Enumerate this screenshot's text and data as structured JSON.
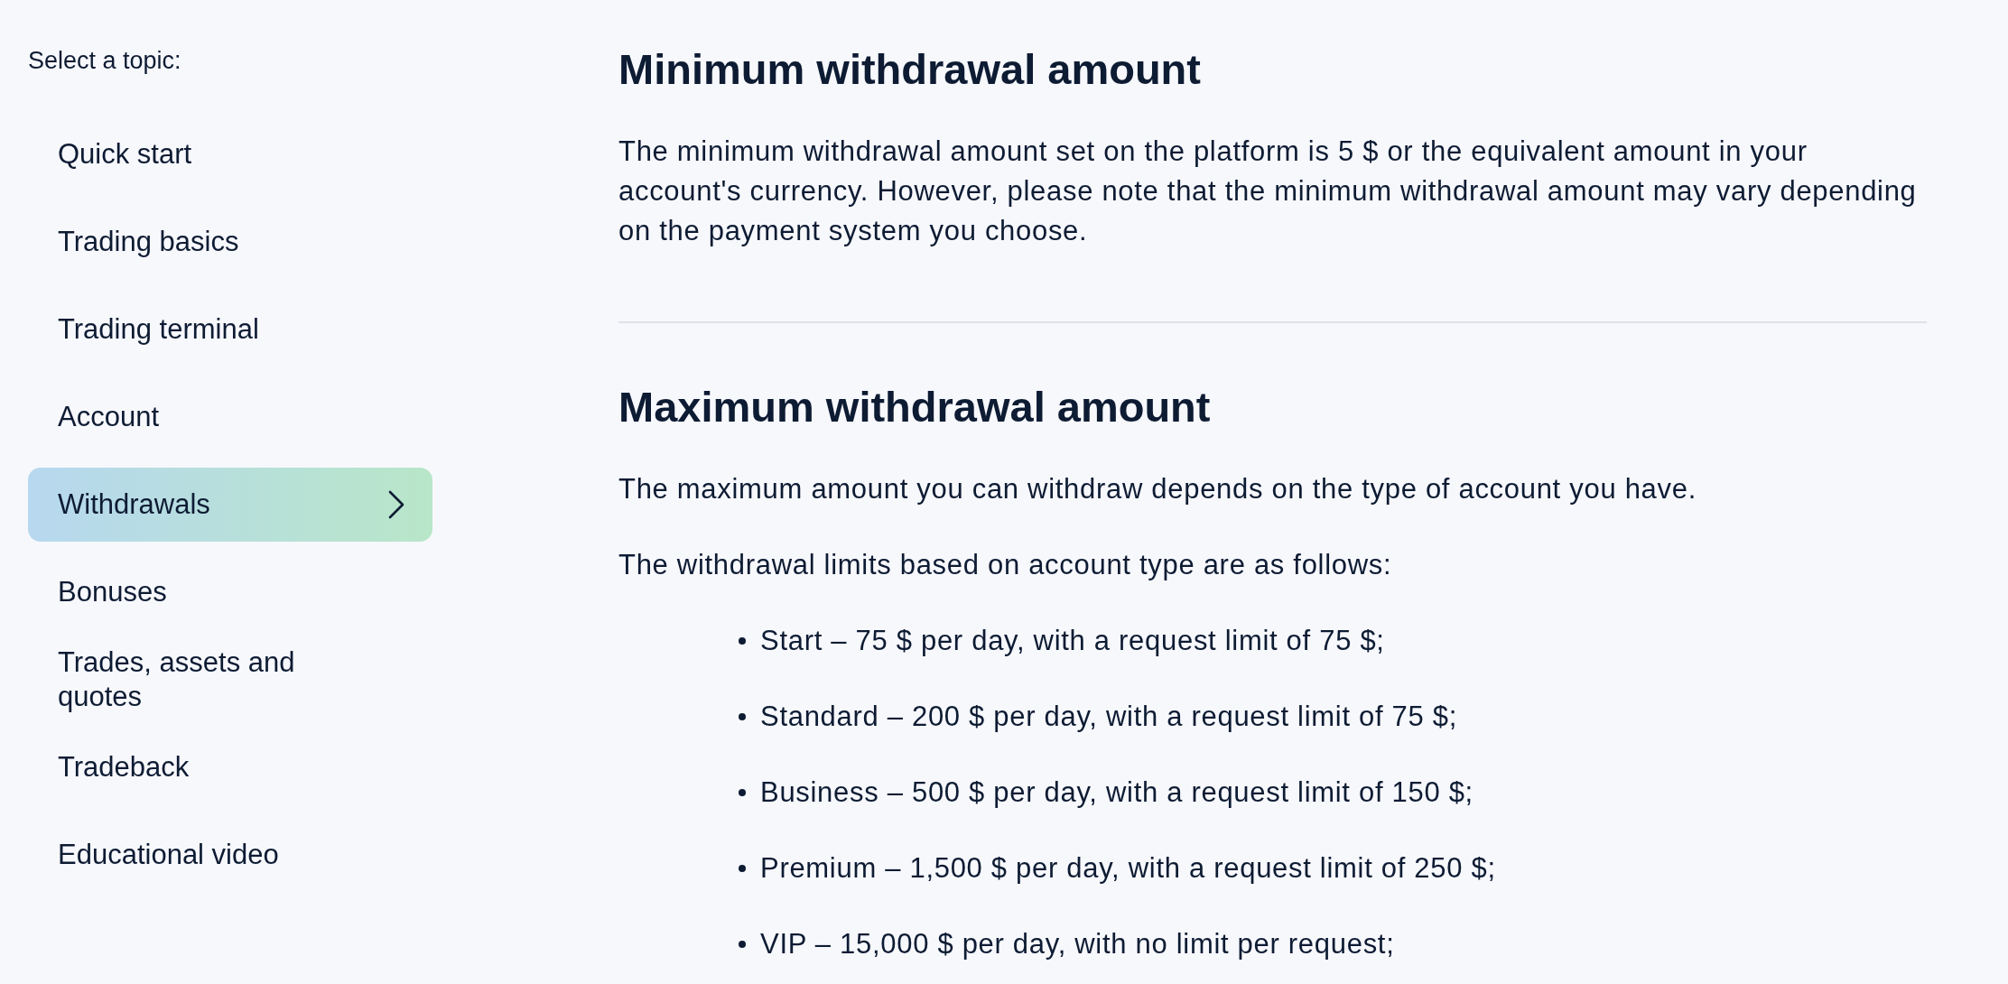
{
  "sidebar": {
    "title": "Select a topic:",
    "items": [
      {
        "label": "Quick start",
        "selected": false
      },
      {
        "label": "Trading basics",
        "selected": false
      },
      {
        "label": "Trading terminal",
        "selected": false
      },
      {
        "label": "Account",
        "selected": false
      },
      {
        "label": "Withdrawals",
        "selected": true
      },
      {
        "label": "Bonuses",
        "selected": false
      },
      {
        "label": "Trades, assets and quotes",
        "selected": false
      },
      {
        "label": "Tradeback",
        "selected": false
      },
      {
        "label": "Educational video",
        "selected": false
      }
    ]
  },
  "sections": [
    {
      "heading": "Minimum withdrawal amount",
      "paragraphs": [
        "The minimum withdrawal amount set on the platform is 5 $ or the equivalent amount in your account's currency. However, please note that the minimum withdrawal amount may vary depending on the payment system you choose."
      ]
    },
    {
      "heading": "Maximum withdrawal amount",
      "paragraphs": [
        "The maximum amount you can withdraw depends on the type of account you have.",
        "The withdrawal limits based on account type are as follows:"
      ],
      "bullets": [
        "Start – 75 $ per day, with a request limit of 75 $;",
        "Standard – 200 $ per day, with a request limit of 75 $;",
        "Business – 500 $ per day, with a request limit of 150 $;",
        "Premium – 1,500 $ per day, with a request limit of 250 $;",
        "VIP – 15,000 $ per day, with no limit per request;"
      ]
    }
  ]
}
